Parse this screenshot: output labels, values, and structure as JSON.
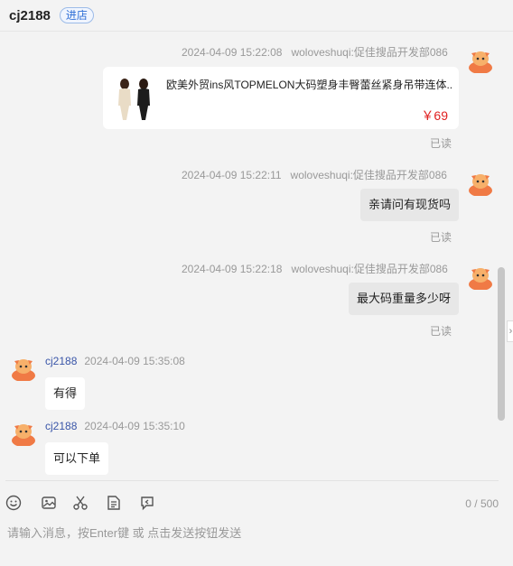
{
  "header": {
    "shop_name": "cj2188",
    "enter_shop_label": "进店"
  },
  "messages": [
    {
      "side": "right",
      "timestamp": "2024-04-09 15:22:08",
      "sender": "woloveshuqi:促佳搜品开发部086",
      "type": "product",
      "product": {
        "title": "欧美外贸ins风TOPMELON大码塑身丰臀蕾丝紧身吊带连体...",
        "price": "￥69"
      },
      "status": "已读"
    },
    {
      "side": "right",
      "timestamp": "2024-04-09 15:22:11",
      "sender": "woloveshuqi:促佳搜品开发部086",
      "text": "亲请问有现货吗",
      "status": "已读"
    },
    {
      "side": "right",
      "timestamp": "2024-04-09 15:22:18",
      "sender": "woloveshuqi:促佳搜品开发部086",
      "text": "最大码重量多少呀",
      "status": "已读"
    },
    {
      "side": "left",
      "sender": "cj2188",
      "timestamp": "2024-04-09 15:35:08",
      "text": "有得"
    },
    {
      "side": "left",
      "sender": "cj2188",
      "timestamp": "2024-04-09 15:35:10",
      "text": "可以下单"
    }
  ],
  "toolbar": {
    "icons": [
      "emoji-icon",
      "image-icon",
      "scissors-icon",
      "order-icon",
      "quick-reply-icon"
    ],
    "counter": "0 / 500"
  },
  "input": {
    "placeholder": "请输入消息，按Enter键 或 点击发送按钮发送",
    "value": ""
  },
  "colors": {
    "accent": "#2f6fd6",
    "price": "#e02020",
    "avatar": "#f07a45"
  }
}
